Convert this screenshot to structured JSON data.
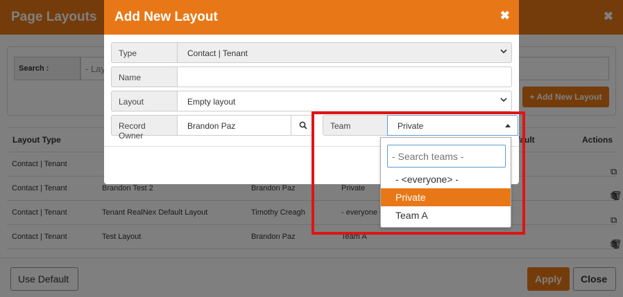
{
  "background": {
    "title": "Page Layouts",
    "close_glyph": "✖",
    "search_label": "Search :",
    "search_value": "- Lay",
    "add_new_layout_btn": "Add New Layout",
    "table": {
      "headers": [
        "Layout Type",
        "Default",
        "Actions"
      ],
      "rows": [
        {
          "type": "Contact | Tenant",
          "name": "",
          "owner": "",
          "team": ""
        },
        {
          "type": "Contact | Tenant",
          "name": "Brandon Test 2",
          "owner": "Brandon Paz",
          "team": "Private"
        },
        {
          "type": "Contact | Tenant",
          "name": "Tenant RealNex Default Layout",
          "owner": "Timothy Creagh",
          "team": "- everyone -"
        },
        {
          "type": "Contact | Tenant",
          "name": "Test Layout",
          "owner": "Brandon Paz",
          "team": "Team A"
        }
      ]
    },
    "footer": {
      "use_default": "Use Default",
      "apply": "Apply",
      "close": "Close"
    }
  },
  "modal": {
    "title": "Add New Layout",
    "close_glyph": "✖",
    "fields": {
      "type": {
        "label": "Type",
        "value": "Contact | Tenant"
      },
      "name": {
        "label": "Name",
        "value": ""
      },
      "layout": {
        "label": "Layout",
        "value": "Empty layout"
      },
      "record_owner": {
        "label": "Record Owner",
        "value": "Brandon Paz"
      },
      "team": {
        "label": "Team",
        "value": "Private"
      }
    }
  },
  "team_dropdown": {
    "search_placeholder": "- Search teams -",
    "options": [
      "- <everyone> -",
      "Private",
      "Team A"
    ],
    "selected": "Private"
  },
  "colors": {
    "accent": "#e87817",
    "highlight": "#e01414",
    "focus": "#5b9bd5"
  }
}
